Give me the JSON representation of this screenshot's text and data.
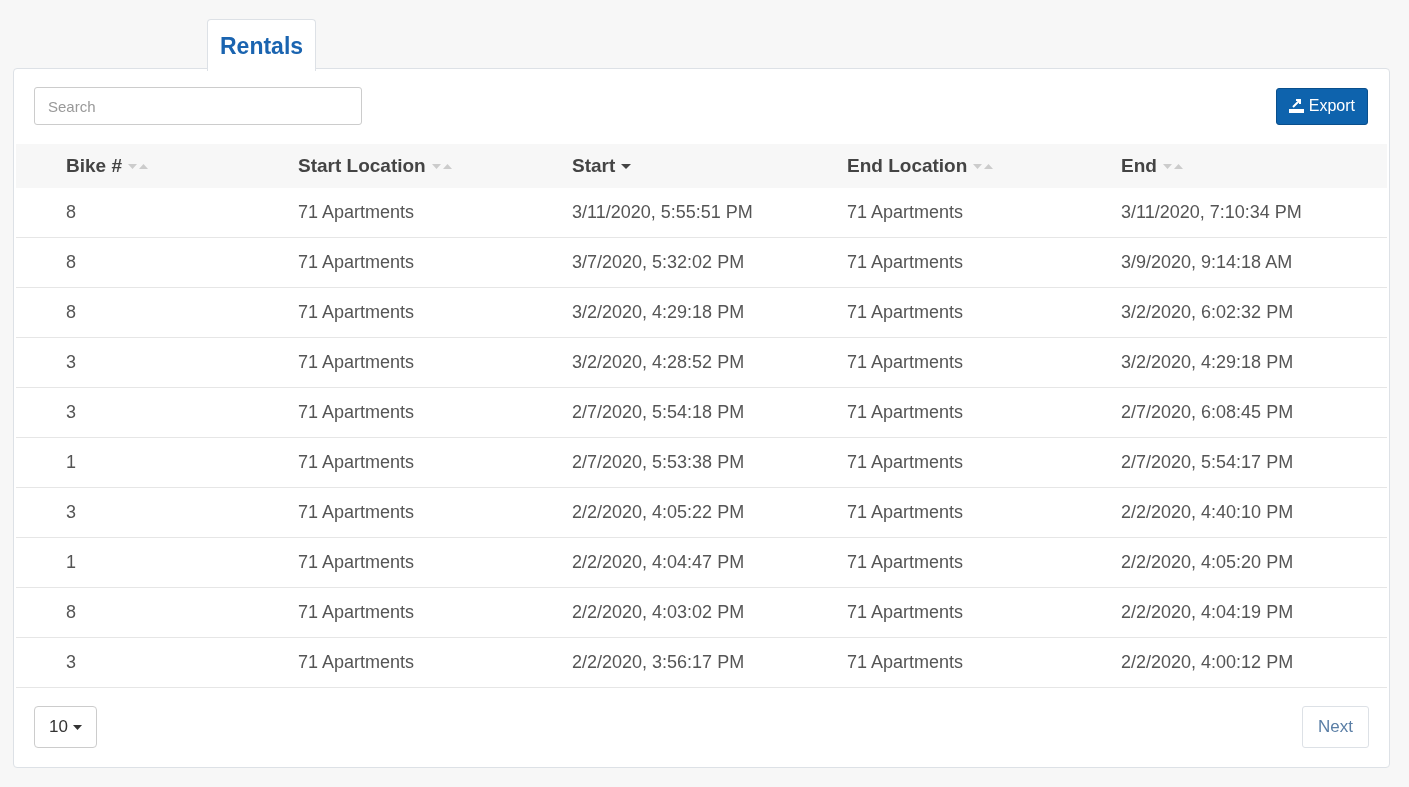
{
  "tabs": [
    {
      "label": "Rentals",
      "selected": true
    }
  ],
  "search": {
    "placeholder": "Search"
  },
  "export_button": {
    "label": "Export"
  },
  "table": {
    "columns": [
      {
        "label": "Bike #",
        "sorted": false
      },
      {
        "label": "Start Location",
        "sorted": false
      },
      {
        "label": "Start",
        "sorted": true
      },
      {
        "label": "End Location",
        "sorted": false
      },
      {
        "label": "End",
        "sorted": false
      }
    ],
    "rows": [
      [
        "8",
        "71 Apartments",
        "3/11/2020, 5:55:51 PM",
        "71 Apartments",
        "3/11/2020, 7:10:34 PM"
      ],
      [
        "8",
        "71 Apartments",
        "3/7/2020, 5:32:02 PM",
        "71 Apartments",
        "3/9/2020, 9:14:18 AM"
      ],
      [
        "8",
        "71 Apartments",
        "3/2/2020, 4:29:18 PM",
        "71 Apartments",
        "3/2/2020, 6:02:32 PM"
      ],
      [
        "3",
        "71 Apartments",
        "3/2/2020, 4:28:52 PM",
        "71 Apartments",
        "3/2/2020, 4:29:18 PM"
      ],
      [
        "3",
        "71 Apartments",
        "2/7/2020, 5:54:18 PM",
        "71 Apartments",
        "2/7/2020, 6:08:45 PM"
      ],
      [
        "1",
        "71 Apartments",
        "2/7/2020, 5:53:38 PM",
        "71 Apartments",
        "2/7/2020, 5:54:17 PM"
      ],
      [
        "3",
        "71 Apartments",
        "2/2/2020, 4:05:22 PM",
        "71 Apartments",
        "2/2/2020, 4:40:10 PM"
      ],
      [
        "1",
        "71 Apartments",
        "2/2/2020, 4:04:47 PM",
        "71 Apartments",
        "2/2/2020, 4:05:20 PM"
      ],
      [
        "8",
        "71 Apartments",
        "2/2/2020, 4:03:02 PM",
        "71 Apartments",
        "2/2/2020, 4:04:19 PM"
      ],
      [
        "3",
        "71 Apartments",
        "2/2/2020, 3:56:17 PM",
        "71 Apartments",
        "2/2/2020, 4:00:12 PM"
      ]
    ]
  },
  "page_size": {
    "value": "10"
  },
  "pagination": {
    "next": "Next"
  }
}
